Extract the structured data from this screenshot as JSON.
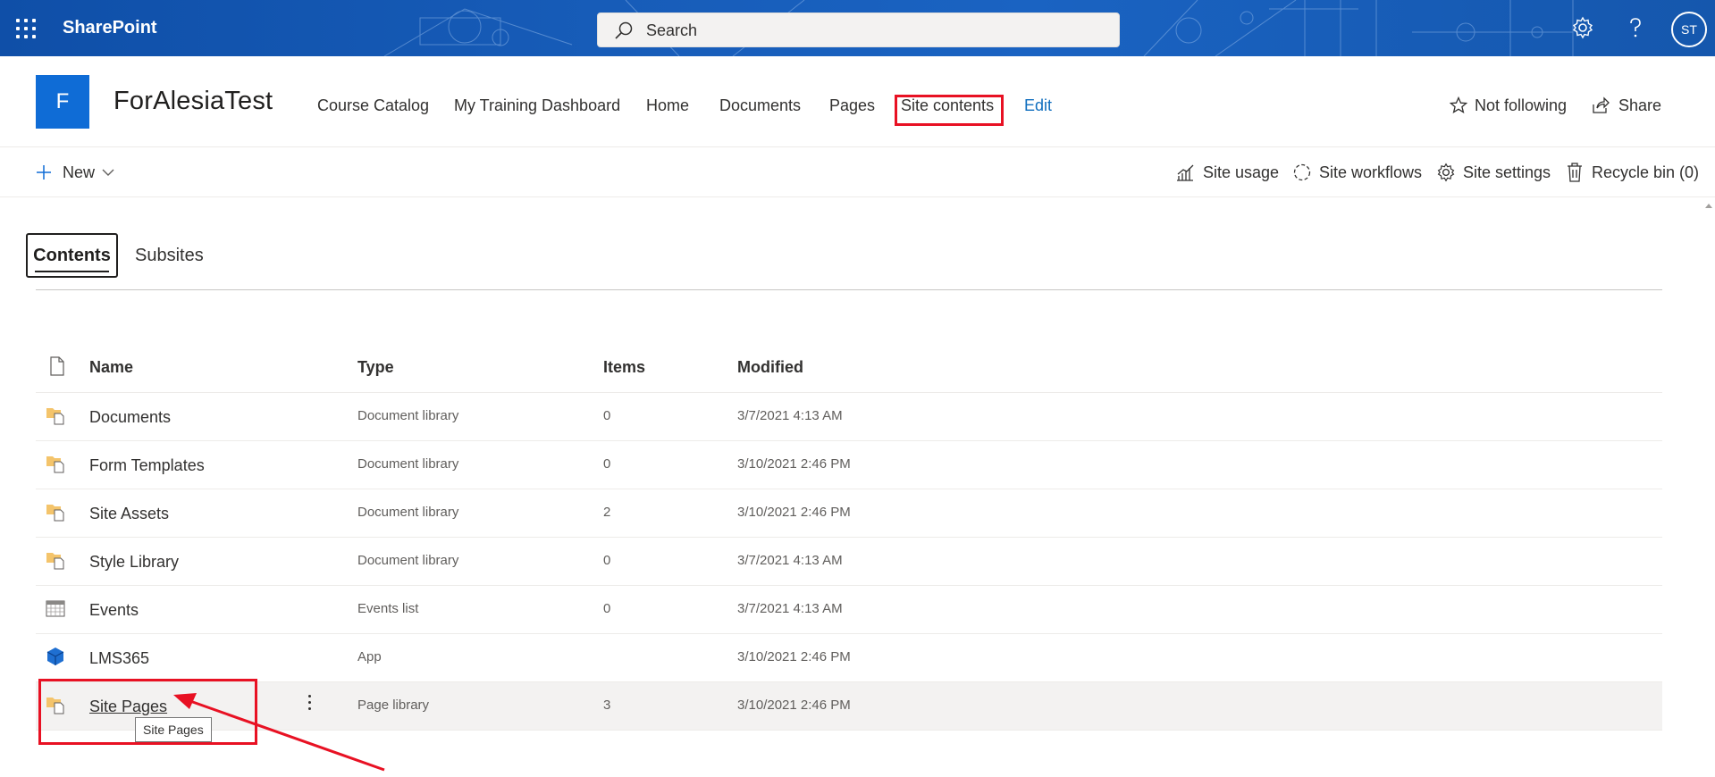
{
  "suitebar": {
    "brand": "SharePoint",
    "search_placeholder": "Search",
    "avatar_initials": "ST"
  },
  "site": {
    "logo_letter": "F",
    "title": "ForAlesiaTest",
    "nav": [
      "Course Catalog",
      "My Training Dashboard",
      "Home",
      "Documents",
      "Pages",
      "Site contents",
      "Edit"
    ],
    "follow_label": "Not following",
    "share_label": "Share"
  },
  "commandbar": {
    "new_label": "New",
    "site_usage": "Site usage",
    "site_workflows": "Site workflows",
    "site_settings": "Site settings",
    "recycle_bin": "Recycle bin (0)"
  },
  "tabs": {
    "contents": "Contents",
    "subsites": "Subsites"
  },
  "table": {
    "headers": {
      "name": "Name",
      "type": "Type",
      "items": "Items",
      "modified": "Modified"
    },
    "rows": [
      {
        "name": "Documents",
        "type": "Document library",
        "items": "0",
        "modified": "3/7/2021 4:13 AM",
        "icon": "library-icon"
      },
      {
        "name": "Form Templates",
        "type": "Document library",
        "items": "0",
        "modified": "3/10/2021 2:46 PM",
        "icon": "library-icon"
      },
      {
        "name": "Site Assets",
        "type": "Document library",
        "items": "2",
        "modified": "3/10/2021 2:46 PM",
        "icon": "library-icon"
      },
      {
        "name": "Style Library",
        "type": "Document library",
        "items": "0",
        "modified": "3/7/2021 4:13 AM",
        "icon": "library-icon"
      },
      {
        "name": "Events",
        "type": "Events list",
        "items": "0",
        "modified": "3/7/2021 4:13 AM",
        "icon": "calendar-icon"
      },
      {
        "name": "LMS365",
        "type": "App",
        "items": "",
        "modified": "3/10/2021 2:46 PM",
        "icon": "app-cube-icon"
      },
      {
        "name": "Site Pages",
        "type": "Page library",
        "items": "3",
        "modified": "3/10/2021 2:46 PM",
        "icon": "library-icon"
      }
    ]
  },
  "tooltip": "Site Pages",
  "colors": {
    "suitebar": "#175cb8",
    "accent": "#0f6cd6",
    "annotation": "#e81123"
  }
}
